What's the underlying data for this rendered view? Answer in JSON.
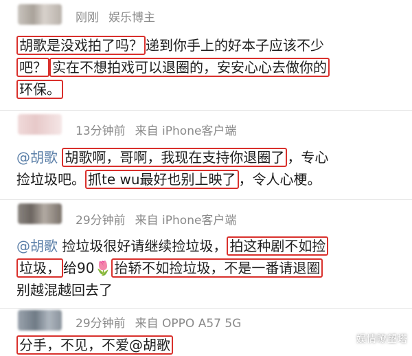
{
  "comments": [
    {
      "name": "刚刚",
      "role": "娱乐博主",
      "lines": [
        {
          "parts": [
            {
              "t": "胡歌是没戏拍了吗？",
              "hl": true
            },
            {
              "t": "递到你手上的好本子应该不少"
            }
          ]
        },
        {
          "parts": [
            {
              "t": "吧？",
              "hl": true
            },
            {
              "t": "实在不想拍戏可以退圈的，安安心心去做你的",
              "hl": true
            }
          ]
        },
        {
          "parts": [
            {
              "t": "环保。",
              "hl": true
            }
          ]
        }
      ]
    },
    {
      "time": "13分钟前",
      "source": "来自 iPhone客户端",
      "lines": [
        {
          "parts": [
            {
              "t": "@胡歌",
              "mention": true
            },
            {
              "t": " "
            },
            {
              "t": "胡歌啊，哥啊，我现在支持你退圈了",
              "hl": true
            },
            {
              "t": "，专心"
            }
          ]
        },
        {
          "parts": [
            {
              "t": "捡垃圾吧。"
            },
            {
              "t": "抓te wu最好也别上映了",
              "hl": true
            },
            {
              "t": "，令人心梗。"
            }
          ]
        }
      ]
    },
    {
      "time": "29分钟前",
      "source": "来自 iPhone客户端",
      "lines": [
        {
          "parts": [
            {
              "t": "@胡歌",
              "mention": true
            },
            {
              "t": " 捡垃圾很好请继续捡垃圾，"
            },
            {
              "t": "拍这种剧不如捡",
              "hl": true
            }
          ]
        },
        {
          "parts": [
            {
              "t": "垃圾，",
              "hl": true
            },
            {
              "t": "给90"
            },
            {
              "t": "🌷",
              "tulip": true
            },
            {
              "t": "抬轿不如捡垃圾，不是一番请退圈",
              "hl": true
            }
          ]
        },
        {
          "parts": [
            {
              "t": "别越混越回去了"
            }
          ]
        }
      ]
    },
    {
      "time": "29分钟前",
      "source": "来自 OPPO A57 5G",
      "lines": [
        {
          "parts": [
            {
              "t": "分手，不见，不爱@胡歌",
              "hl": true
            }
          ]
        }
      ]
    }
  ],
  "watermark": "娱情瞭望塔"
}
